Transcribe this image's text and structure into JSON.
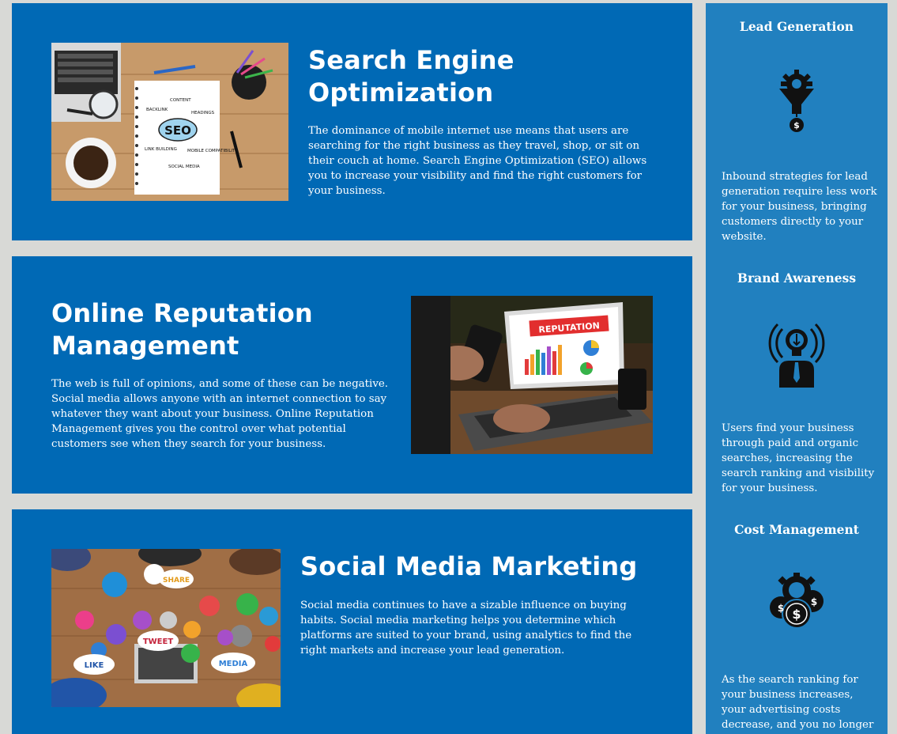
{
  "sections": [
    {
      "title": "Search Engine Optimization",
      "body": "The dominance of mobile internet use means that users are searching for the right business as they travel, shop, or sit on their couch at home. Search Engine Optimization (SEO) allows you to increase your visibility and find the right customers for your business.",
      "image_text": {
        "center": "SEO",
        "tags": [
          "CONTENT",
          "HEADINGS",
          "BACKLINK",
          "LINK BUILDING",
          "MOBILE COMPATIBILITY",
          "SOCIAL MEDIA"
        ]
      }
    },
    {
      "title": "Online Reputation Management",
      "body": "The web is full of opinions, and some of these can be negative. Social media allows anyone with an internet connection to say whatever they want about your business. Online Reputation Management gives you the control over what potential customers see when they search for your business.",
      "image_text": {
        "banner": "REPUTATION"
      }
    },
    {
      "title": "Social Media Marketing",
      "body": "Social media continues to have a sizable influence on buying habits. Social media marketing helps you determine which platforms are suited to your brand, using analytics to find the right markets and increase your lead generation.",
      "image_text": {
        "bubbles": [
          "SHARE",
          "TWEET",
          "LIKE",
          "MEDIA"
        ]
      }
    }
  ],
  "sidebar": [
    {
      "title": "Lead Generation",
      "icon": "funnel-gear-dollar-icon",
      "body": "Inbound strategies for lead generation require less work for your business, bringing customers directly to your website."
    },
    {
      "title": "Brand Awareness",
      "icon": "lightbulb-broadcast-person-icon",
      "body": "Users find your business through paid and organic searches, increasing the search ranking and visibility for your business."
    },
    {
      "title": "Cost Management",
      "icon": "gear-coins-dollar-icon",
      "body": "As the search ranking for your business increases, your advertising costs decrease, and you no longer need to"
    }
  ],
  "colors": {
    "page_background": "#d8d9d6",
    "section_blue": "#0069b5",
    "sidebar_blue": "#2180bf",
    "text": "#ffffff"
  }
}
